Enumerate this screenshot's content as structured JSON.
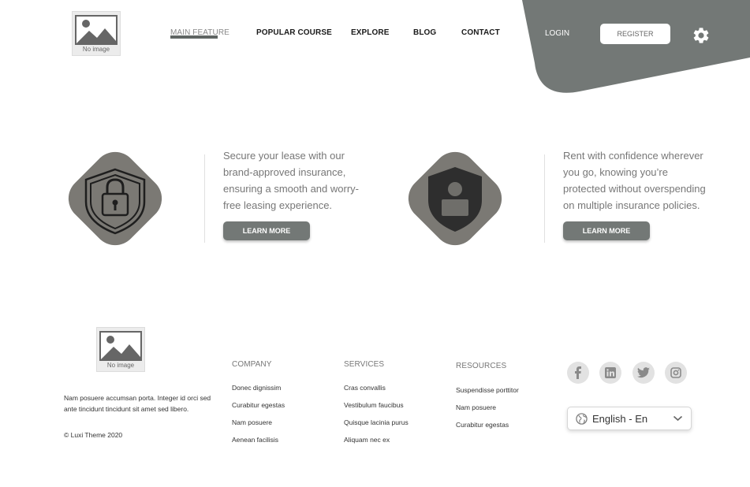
{
  "header": {
    "logo_caption": "No image",
    "nav": [
      {
        "label": "MAIN FEATURE",
        "active": true
      },
      {
        "label": "POPULAR COURSE",
        "active": false
      },
      {
        "label": "EXPLORE",
        "active": false
      },
      {
        "label": "BLOG",
        "active": false
      },
      {
        "label": "CONTACT",
        "active": false
      }
    ],
    "login_label": "LOGIN",
    "register_label": "REGISTER",
    "settings_icon": "gear-icon",
    "accent_color": "#737876"
  },
  "features": [
    {
      "icon": "lock-shield-icon",
      "text": "Secure your lease with our brand-approved insurance, ensuring a smooth and worry-free leasing experience.",
      "button_label": "LEARN MORE"
    },
    {
      "icon": "user-shield-icon",
      "text": "Rent with confidence wherever you go, knowing you’re protected without overspending on multiple insurance policies.",
      "button_label": "LEARN MORE"
    }
  ],
  "footer": {
    "logo_caption": "No image",
    "description": "Nam posuere accumsan porta. Integer id orci sed ante tincidunt tincidunt sit amet sed libero.",
    "copyright": "© Luxi Theme 2020",
    "columns": [
      {
        "title": "COMPANY",
        "links": [
          "Donec dignissim",
          "Curabitur egestas",
          "Nam posuere",
          "Aenean facilisis"
        ]
      },
      {
        "title": "SERVICES",
        "links": [
          "Cras convallis",
          "Vestibulum faucibus",
          "Quisque lacinia purus",
          "Aliquam nec ex"
        ]
      },
      {
        "title": "RESOURCES",
        "links": [
          "Suspendisse porttitor",
          "Nam posuere",
          "Curabitur egestas"
        ]
      }
    ],
    "social": [
      "facebook-icon",
      "linkedin-icon",
      "twitter-icon",
      "instagram-icon"
    ],
    "language": "English - En"
  }
}
